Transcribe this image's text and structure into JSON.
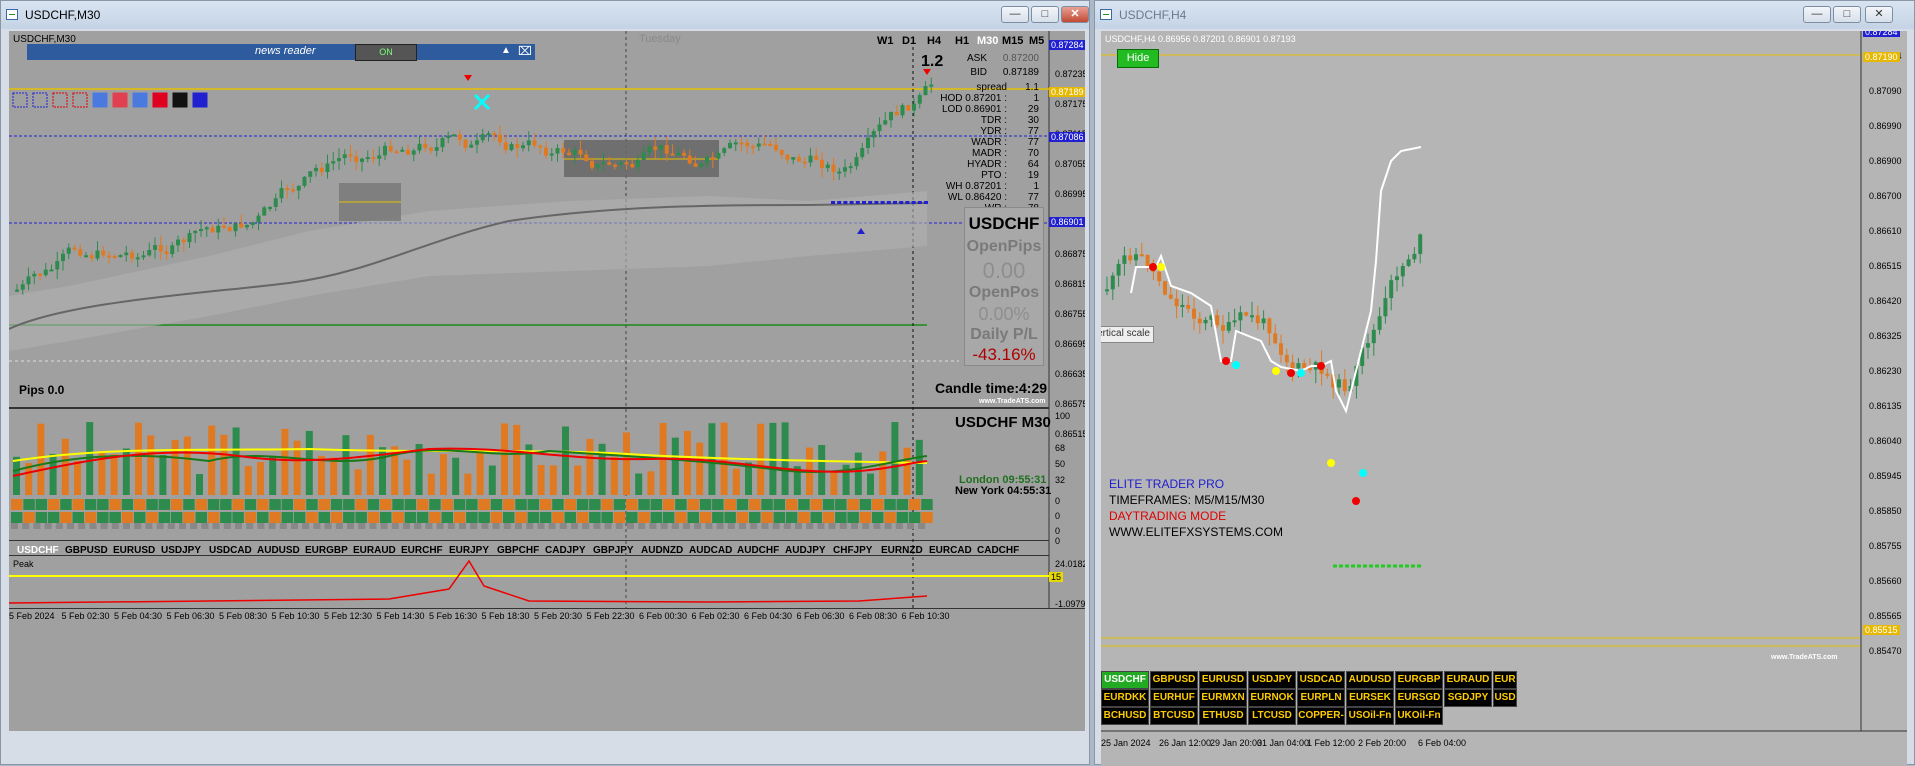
{
  "left_window": {
    "title": "USDCHF,M30",
    "chart_label": "USDCHF,M30",
    "day_label": "Tuesday",
    "timeframes": [
      "W1",
      "D1",
      "H4",
      "H1",
      "M30",
      "M15",
      "M5"
    ],
    "active_timeframe": "M30",
    "news_reader": {
      "label": "news reader",
      "toggle": "ON"
    },
    "signal_value": "1.2",
    "quotes": {
      "ask_label": "ASK",
      "ask": "0.87200",
      "bid_label": "BID",
      "bid": "0.87189",
      "spread_label": "spread",
      "spread": "1.1"
    },
    "stats": [
      {
        "label": "HOD 0.87201 :",
        "value": "1"
      },
      {
        "label": "LOD 0.86901 :",
        "value": "29"
      },
      {
        "label": "TDR :",
        "value": "30"
      },
      {
        "label": "YDR :",
        "value": "77"
      },
      {
        "label": "WADR :",
        "value": "77"
      },
      {
        "label": "MADR :",
        "value": "70"
      },
      {
        "label": "HYADR :",
        "value": "64"
      },
      {
        "label": "PTO :",
        "value": "19"
      },
      {
        "label": "WH 0.87201 :",
        "value": "1"
      },
      {
        "label": "WL 0.86420 :",
        "value": "77"
      },
      {
        "label": "WR :",
        "value": "78"
      }
    ],
    "panel": {
      "symbol": "USDCHF",
      "open_pips_label": "OpenPips",
      "open_pips": "0.00",
      "open_pos_label": "OpenPos",
      "open_pos": "0.00%",
      "daily_pl_label": "Daily P/L",
      "daily_pl": "-43.16%"
    },
    "candle_time_label": "Candle time:",
    "candle_time": "4:29",
    "watermark": "www.TradeATS.com",
    "pips": "Pips 0.0",
    "price_scale": [
      "0.87284",
      "0.87235",
      "0.87175",
      "0.87115",
      "0.87055",
      "0.86995",
      "0.86935",
      "0.86875",
      "0.86815",
      "0.86755",
      "0.86695",
      "0.86635",
      "0.86575",
      "0.86515"
    ],
    "price_tags": [
      {
        "value": "0.87284",
        "color": "#2020d0"
      },
      {
        "value": "0.87189",
        "color": "#e6b800"
      },
      {
        "value": "0.87086",
        "color": "#2020d0"
      },
      {
        "value": "0.86901",
        "color": "#2020d0"
      }
    ],
    "sub_title": "USDCHF  M30",
    "sessions": [
      {
        "name": "London",
        "time": "09:55:31",
        "color": "#207020"
      },
      {
        "name": "New York",
        "time": "04:55:31",
        "color": "#000000"
      }
    ],
    "sub_scale": [
      "100",
      "68",
      "50",
      "32",
      "0",
      "0",
      "0",
      "0"
    ],
    "symbols": [
      "USDCHF",
      "GBPUSD",
      "EURUSD",
      "USDJPY",
      "USDCAD",
      "AUDUSD",
      "EURGBP",
      "EURAUD",
      "EURCHF",
      "EURJPY",
      "GBPCHF",
      "CADJPY",
      "GBPJPY",
      "AUDNZD",
      "AUDCAD",
      "AUDCHF",
      "AUDJPY",
      "CHFJPY",
      "EURNZD",
      "EURCAD",
      "CADCHF"
    ],
    "peak_label": "Peak",
    "peak_scale": [
      "24.0182",
      "15",
      "-1.0979"
    ],
    "time_labels": [
      "5 Feb 2024",
      "5 Feb 02:30",
      "5 Feb 04:30",
      "5 Feb 06:30",
      "5 Feb 08:30",
      "5 Feb 10:30",
      "5 Feb 12:30",
      "5 Feb 14:30",
      "5 Feb 16:30",
      "5 Feb 18:30",
      "5 Feb 20:30",
      "5 Feb 22:30",
      "6 Feb 00:30",
      "6 Feb 02:30",
      "6 Feb 04:30",
      "6 Feb 06:30",
      "6 Feb 08:30",
      "6 Feb 10:30"
    ]
  },
  "right_window": {
    "title": "USDCHF,H4",
    "chart_label": "USDCHF,H4  0.86956 0.87201 0.86901 0.87193",
    "hide_button": "Hide",
    "tooltip": "Vertical scale",
    "texts": [
      {
        "text": "ELITE TRADER PRO",
        "color": "#2020d0"
      },
      {
        "text": "TIMEFRAMES: M5/M15/M30",
        "color": "#000000"
      },
      {
        "text": "DAYTRADING MODE",
        "color": "#e00000"
      },
      {
        "text": "WWW.ELITEFXSYSTEMS.COM",
        "color": "#000000"
      }
    ],
    "price_scale": [
      "0.87284",
      "0.87090",
      "0.86990",
      "0.86900",
      "0.86700",
      "0.86610",
      "0.86515",
      "0.86420",
      "0.86325",
      "0.86230",
      "0.86135",
      "0.86040",
      "0.85945",
      "0.85850",
      "0.85755",
      "0.85660",
      "0.85565",
      "0.85470"
    ],
    "symbol_buttons": [
      [
        "USDCHF",
        "GBPUSD",
        "EURUSD",
        "USDJPY",
        "USDCAD",
        "AUDUSD",
        "EURGBP",
        "EURAUD",
        "EUR"
      ],
      [
        "EURDKK",
        "EURHUF",
        "EURMXN",
        "EURNOK",
        "EURPLN",
        "EURSEK",
        "EURSGD",
        "SGDJPY",
        "USD"
      ],
      [
        "BCHUSD",
        "BTCUSD",
        "ETHUSD",
        "LTCUSD",
        "COPPER-F",
        "USOil-Fn",
        "UKOil-Fn"
      ]
    ],
    "time_labels": [
      "25 Jan 2024",
      "26 Jan 12:00",
      "29 Jan 20:00",
      "31 Jan 04:00",
      "1 Feb 12:00",
      "2 Feb 20:00",
      "6 Feb 04:00"
    ],
    "watermark": "www.TradeATS.com",
    "price_tags": [
      {
        "value": "0.87284",
        "color": "#2020d0"
      },
      {
        "value": "0.87190",
        "color": "#e6b800"
      },
      {
        "value": "0.85515",
        "color": "#e6b800"
      }
    ]
  }
}
